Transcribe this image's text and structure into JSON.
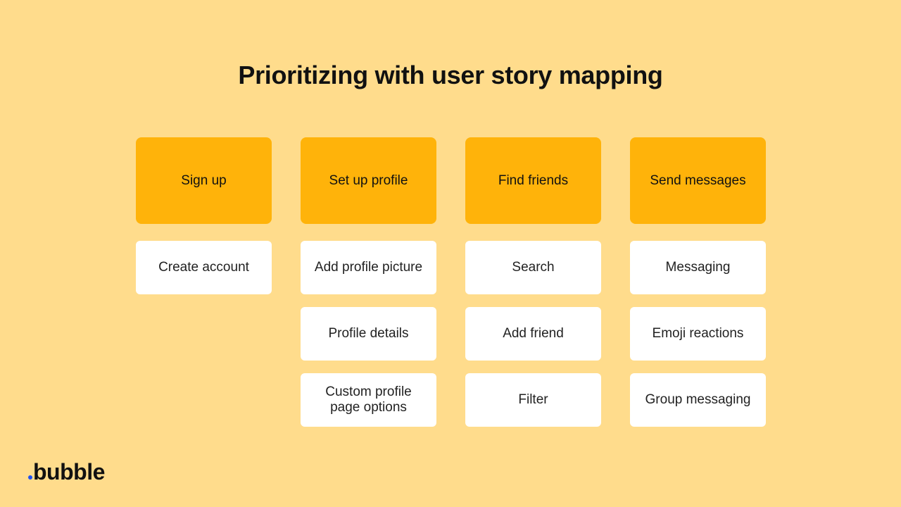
{
  "title": "Prioritizing with user story mapping",
  "columns": [
    {
      "activity": "Sign up",
      "tasks": [
        "Create account"
      ]
    },
    {
      "activity": "Set up profile",
      "tasks": [
        "Add profile picture",
        "Profile details",
        "Custom profile page options"
      ]
    },
    {
      "activity": "Find friends",
      "tasks": [
        "Search",
        "Add friend",
        "Filter"
      ]
    },
    {
      "activity": "Send messages",
      "tasks": [
        "Messaging",
        "Emoji reactions",
        "Group messaging"
      ]
    }
  ],
  "logo": {
    "text": "bubble"
  },
  "colors": {
    "background": "#FFDC8C",
    "activity": "#FFB30A",
    "task": "#FFFFFF",
    "logo_dot": "#1F4FF0"
  }
}
